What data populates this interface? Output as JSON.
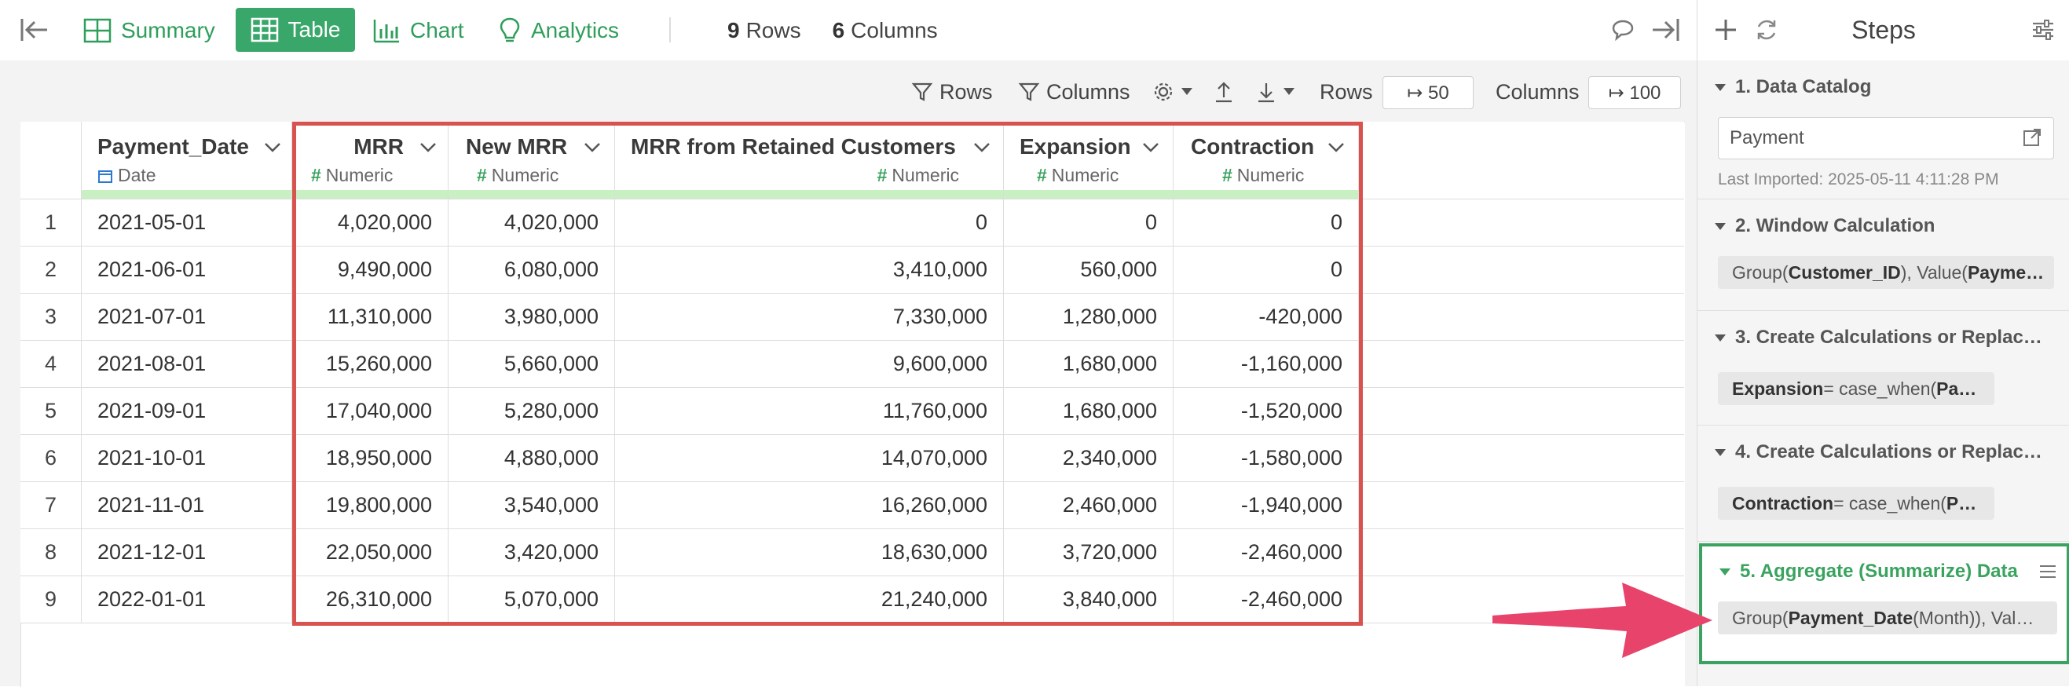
{
  "toolbar": {
    "summary_label": "Summary",
    "table_label": "Table",
    "chart_label": "Chart",
    "analytics_label": "Analytics",
    "rows_count": "9",
    "rows_word": "Rows",
    "cols_count": "6",
    "cols_word": "Columns"
  },
  "subtoolbar": {
    "rows_filter_label": "Rows",
    "columns_filter_label": "Columns",
    "rows_label": "Rows",
    "rows_limit": "↦ 50",
    "columns_label": "Columns",
    "columns_limit": "↦ 100"
  },
  "table": {
    "columns": [
      {
        "name": "Payment_Date",
        "type": "Date"
      },
      {
        "name": "MRR",
        "type": "Numeric"
      },
      {
        "name": "New MRR",
        "type": "Numeric"
      },
      {
        "name": "MRR from Retained Customers",
        "type": "Numeric"
      },
      {
        "name": "Expansion",
        "type": "Numeric"
      },
      {
        "name": "Contraction",
        "type": "Numeric"
      }
    ],
    "rows": [
      [
        "1",
        "2021-05-01",
        "4,020,000",
        "4,020,000",
        "0",
        "0",
        "0"
      ],
      [
        "2",
        "2021-06-01",
        "9,490,000",
        "6,080,000",
        "3,410,000",
        "560,000",
        "0"
      ],
      [
        "3",
        "2021-07-01",
        "11,310,000",
        "3,980,000",
        "7,330,000",
        "1,280,000",
        "-420,000"
      ],
      [
        "4",
        "2021-08-01",
        "15,260,000",
        "5,660,000",
        "9,600,000",
        "1,680,000",
        "-1,160,000"
      ],
      [
        "5",
        "2021-09-01",
        "17,040,000",
        "5,280,000",
        "11,760,000",
        "1,680,000",
        "-1,520,000"
      ],
      [
        "6",
        "2021-10-01",
        "18,950,000",
        "4,880,000",
        "14,070,000",
        "2,340,000",
        "-1,580,000"
      ],
      [
        "7",
        "2021-11-01",
        "19,800,000",
        "3,540,000",
        "16,260,000",
        "2,460,000",
        "-1,940,000"
      ],
      [
        "8",
        "2021-12-01",
        "22,050,000",
        "3,420,000",
        "18,630,000",
        "3,720,000",
        "-2,460,000"
      ],
      [
        "9",
        "2022-01-01",
        "26,310,000",
        "5,070,000",
        "21,240,000",
        "3,840,000",
        "-2,460,000"
      ]
    ]
  },
  "steps": {
    "title": "Steps",
    "items": [
      {
        "title": "1. Data Catalog",
        "input_value": "Payment",
        "note": "Last Imported: 2025-05-11 4:11:28 PM"
      },
      {
        "title": "2. Window Calculation",
        "chip": [
          {
            "t": "Group(",
            "b": false
          },
          {
            "t": "Customer_ID",
            "b": true
          },
          {
            "t": "), Value(",
            "b": false
          },
          {
            "t": "Payme…",
            "b": true
          }
        ]
      },
      {
        "title": "3. Create Calculations or Replac…",
        "chip": [
          {
            "t": "Expansion",
            "b": true
          },
          {
            "t": " = case_when(",
            "b": false
          },
          {
            "t": "Pa…",
            "b": true
          }
        ]
      },
      {
        "title": "4. Create Calculations or Replac…",
        "chip": [
          {
            "t": "Contraction",
            "b": true
          },
          {
            "t": " = case_when(",
            "b": false
          },
          {
            "t": "P…",
            "b": true
          }
        ]
      },
      {
        "title": "5. Aggregate (Summarize) Data",
        "chip": [
          {
            "t": "Group(",
            "b": false
          },
          {
            "t": "Payment_Date",
            "b": true
          },
          {
            "t": " (Month)), Val…",
            "b": false
          }
        ]
      }
    ]
  },
  "colors": {
    "accent_green": "#39a76a",
    "highlight_red": "#d8534f",
    "arrow_pink": "#e8436b"
  }
}
